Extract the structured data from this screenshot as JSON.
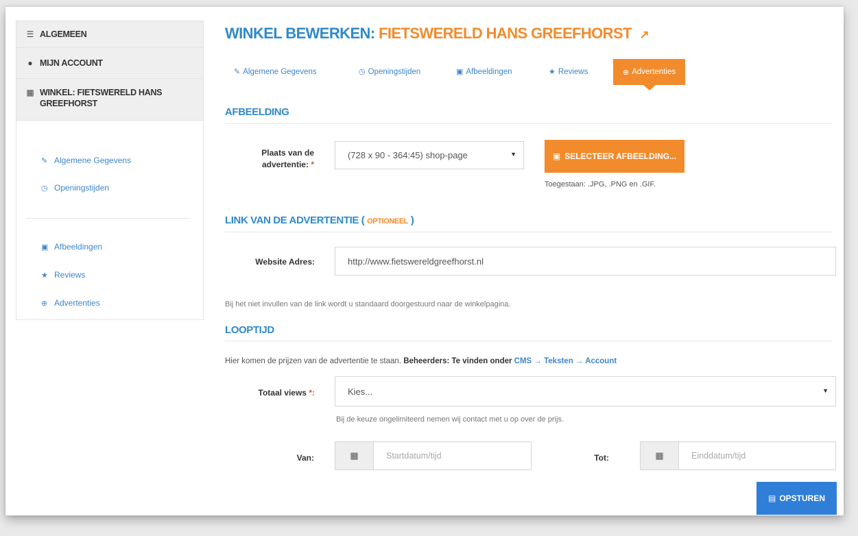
{
  "sidebar": {
    "sections": [
      {
        "label": "Algemeen",
        "icon": "sliders-icon"
      },
      {
        "label": "Mijn account",
        "icon": "user-icon"
      },
      {
        "label": "Winkel: Fietswereld Hans Greefhorst",
        "icon": "building-icon"
      }
    ],
    "links": [
      {
        "label": "Algemene Gegevens",
        "icon": "edit-icon"
      },
      {
        "label": "Openingstijden",
        "icon": "clock-icon"
      },
      {
        "label": "Afbeeldingen",
        "icon": "image-icon"
      },
      {
        "label": "Reviews",
        "icon": "star-half-icon"
      },
      {
        "label": "Advertenties",
        "icon": "plus-circle-icon"
      }
    ]
  },
  "header": {
    "title_prefix": "WINKEL BEWERKEN:",
    "title_shop": "FIETSWERELD HANS GREEFHORST"
  },
  "tabs": [
    {
      "label": "Algemene Gegevens",
      "icon": "edit-icon"
    },
    {
      "label": "Openingstijden",
      "icon": "clock-icon"
    },
    {
      "label": "Afbeeldingen",
      "icon": "image-icon"
    },
    {
      "label": "Reviews",
      "icon": "star-half-icon"
    },
    {
      "label": "Advertenties",
      "icon": "plus-circle-icon",
      "active": true
    }
  ],
  "afbeelding": {
    "title": "AFBEELDING",
    "placement_label": "Plaats van de advertentie:",
    "placement_required": "*",
    "placement_value": "(728 x 90 - 364:45) shop-page",
    "select_button": "SELECTEER AFBEELDING...",
    "allowed_hint": "Toegestaan: .JPG, .PNG en .GIF."
  },
  "link": {
    "title": "LINK VAN DE ADVERTENTIE (",
    "title_optional": "OPTIONEEL",
    "title_close": ")",
    "website_label": "Website Adres:",
    "website_value": "http://www.fietswereldgreefhorst.nl",
    "note": "Bij het niet invullen van de link wordt u standaard doorgestuurd naar de winkelpagina."
  },
  "looptijd": {
    "title": "LOOPTIJD",
    "info_text": "Hier komen de prijzen van de advertentie te staan.",
    "info_bold": "Beheerders: Te vinden onder",
    "info_link": "CMS → Teksten → Account",
    "views_label": "Totaal views",
    "views_required": "*:",
    "views_value": "Kies...",
    "views_hint": "Bij de keuze ongelimiteerd nemen wij contact met u op over de prijs.",
    "van_label": "Van:",
    "van_placeholder": "Startdatum/tijd",
    "tot_label": "Tot:",
    "tot_placeholder": "Einddatum/tijd"
  },
  "submit": {
    "label": "OPSTUREN",
    "icon": "save-icon"
  },
  "colors": {
    "blue": "#2f8ac9",
    "orange": "#f28b2c",
    "button_blue": "#2f7fd8"
  }
}
